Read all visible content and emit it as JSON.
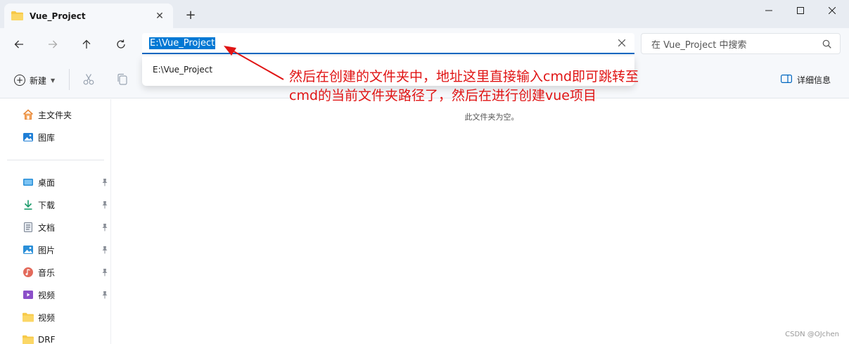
{
  "window": {
    "tab_title": "Vue_Project",
    "new_tab_symbol": "+",
    "tab_close_symbol": "✕"
  },
  "nav": {
    "address_value": "E:\\Vue_Project",
    "search_placeholder": "在 Vue_Project 中搜索",
    "dropdown_suggestion": "E:\\Vue_Project"
  },
  "toolbar": {
    "new_label": "新建",
    "details_label": "详细信息"
  },
  "sidebar": {
    "items": [
      {
        "label": "主文件夹",
        "icon": "home-icon",
        "pinned": false
      },
      {
        "label": "图库",
        "icon": "gallery-icon",
        "pinned": false
      },
      {
        "label": "桌面",
        "icon": "desktop-icon",
        "pinned": true
      },
      {
        "label": "下载",
        "icon": "download-icon",
        "pinned": true
      },
      {
        "label": "文档",
        "icon": "document-icon",
        "pinned": true
      },
      {
        "label": "图片",
        "icon": "pictures-icon",
        "pinned": true
      },
      {
        "label": "音乐",
        "icon": "music-icon",
        "pinned": true
      },
      {
        "label": "视频",
        "icon": "videos-icon",
        "pinned": true
      },
      {
        "label": "视频",
        "icon": "folder-icon",
        "pinned": false
      },
      {
        "label": "DRF",
        "icon": "folder-icon",
        "pinned": false
      }
    ]
  },
  "main": {
    "empty_message": "此文件夹为空。"
  },
  "annotation": {
    "line1": "然后在创建的文件夹中，地址这里直接输入cmd即可跳转至",
    "line2": "cmd的当前文件夹路径了，然后在进行创建vue项目"
  },
  "watermark": "CSDN @OJchen",
  "colors": {
    "accent": "#0078d4",
    "annotation": "#e01414",
    "folder": "#f7c948"
  }
}
